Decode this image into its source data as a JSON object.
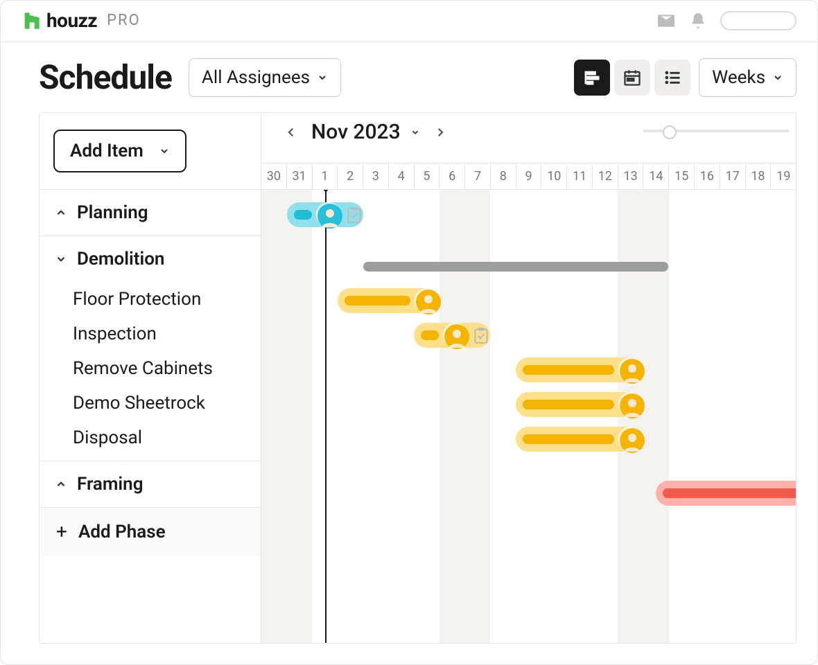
{
  "brand": {
    "name": "houzz",
    "suffix": "PRO"
  },
  "page": {
    "title": "Schedule"
  },
  "toolbar": {
    "assignees_label": "All Assignees",
    "interval_label": "Weeks"
  },
  "add_item_label": "Add Item",
  "month_nav": {
    "label": "Nov 2023"
  },
  "days": [
    "30",
    "31",
    "1",
    "2",
    "3",
    "4",
    "5",
    "6",
    "7",
    "8",
    "9",
    "10",
    "11",
    "12",
    "13",
    "14",
    "15",
    "16",
    "17",
    "18",
    "19"
  ],
  "weekend_indices": [
    0,
    1,
    7,
    8,
    14,
    15
  ],
  "today_index": 2,
  "phases": [
    {
      "name": "Planning",
      "expanded": false
    },
    {
      "name": "Demolition",
      "expanded": true,
      "tasks": [
        "Floor Protection",
        "Inspection",
        "Remove Cabinets",
        "Demo Sheetrock",
        "Disposal"
      ]
    },
    {
      "name": "Framing",
      "expanded": false
    }
  ],
  "add_phase_label": "Add Phase",
  "bars": {
    "planning": {
      "start_idx": 1,
      "span": 3,
      "color_outer": "#8fe0ec",
      "color_inner": "#20bcd6",
      "avatar": "#26c0da",
      "has_check": true
    },
    "demo_summary": {
      "start_idx": 4,
      "span": 12
    },
    "floor": {
      "start_idx": 3,
      "span": 4,
      "color_outer": "#ffe08a",
      "color_inner": "#f5b400",
      "avatar": "#f5b400"
    },
    "inspection": {
      "start_idx": 6,
      "span": 3,
      "color_outer": "#ffe08a",
      "color_inner": "#f5b400",
      "avatar": "#f5b400",
      "has_check": true
    },
    "remove": {
      "start_idx": 10,
      "span": 5,
      "color_outer": "#ffe08a",
      "color_inner": "#f5b400",
      "avatar": "#f5b400"
    },
    "sheetrock": {
      "start_idx": 10,
      "span": 5,
      "color_outer": "#ffe08a",
      "color_inner": "#f5b400",
      "avatar": "#f5b400"
    },
    "disposal": {
      "start_idx": 10,
      "span": 5,
      "color_outer": "#ffe08a",
      "color_inner": "#f5b400",
      "avatar": "#f5b400"
    },
    "framing": {
      "start_idx": 15.5,
      "span": 6,
      "color_outer": "#ffb0a8",
      "color_inner": "#f15a4a"
    }
  },
  "colors": {
    "accent_green": "#4bc14b"
  }
}
